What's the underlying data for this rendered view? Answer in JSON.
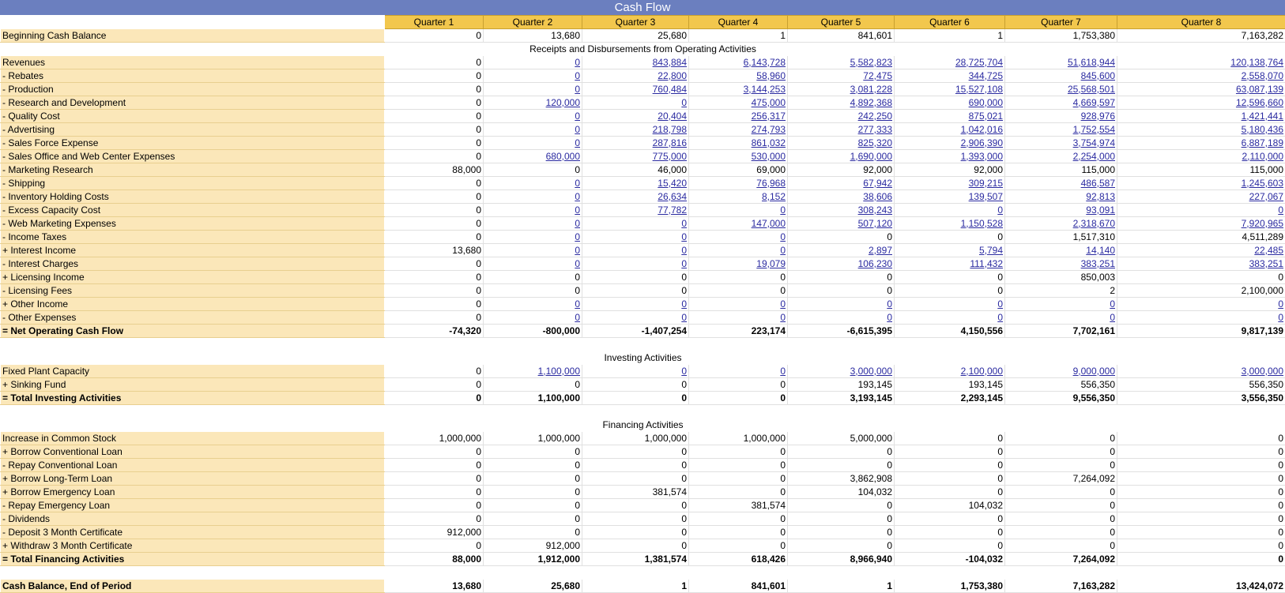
{
  "title": "Cash Flow",
  "quarters": [
    "Quarter 1",
    "Quarter 2",
    "Quarter 3",
    "Quarter 4",
    "Quarter 5",
    "Quarter 6",
    "Quarter 7",
    "Quarter 8"
  ],
  "colors": {
    "title_bar": "#6b7fbf",
    "header": "#f2c74d",
    "label_bg": "#fbe7b9",
    "link": "#2a2aa0"
  },
  "sections": [
    {
      "type": "rows",
      "rows": [
        {
          "label": "Beginning Cash Balance",
          "values": [
            "0",
            "13,680",
            "25,680",
            "1",
            "841,601",
            "1",
            "1,753,380",
            "7,163,282"
          ],
          "links": []
        }
      ]
    },
    {
      "type": "section",
      "title": "Receipts and Disbursements from Operating Activities"
    },
    {
      "type": "rows",
      "rows": [
        {
          "label": "Revenues",
          "values": [
            "0",
            "0",
            "843,884",
            "6,143,728",
            "5,582,823",
            "28,725,704",
            "51,618,944",
            "120,138,764"
          ],
          "links": [
            1,
            2,
            3,
            4,
            5,
            6,
            7
          ]
        },
        {
          "label": "- Rebates",
          "values": [
            "0",
            "0",
            "22,800",
            "58,960",
            "72,475",
            "344,725",
            "845,600",
            "2,558,070"
          ],
          "links": [
            1,
            2,
            3,
            4,
            5,
            6,
            7
          ]
        },
        {
          "label": "- Production",
          "values": [
            "0",
            "0",
            "760,484",
            "3,144,253",
            "3,081,228",
            "15,527,108",
            "25,568,501",
            "63,087,139"
          ],
          "links": [
            1,
            2,
            3,
            4,
            5,
            6,
            7
          ]
        },
        {
          "label": "- Research and Development",
          "values": [
            "0",
            "120,000",
            "0",
            "475,000",
            "4,892,368",
            "690,000",
            "4,669,597",
            "12,596,660"
          ],
          "links": [
            1,
            2,
            3,
            4,
            5,
            6,
            7
          ]
        },
        {
          "label": "- Quality Cost",
          "values": [
            "0",
            "0",
            "20,404",
            "256,317",
            "242,250",
            "875,021",
            "928,976",
            "1,421,441"
          ],
          "links": [
            1,
            2,
            3,
            4,
            5,
            6,
            7
          ]
        },
        {
          "label": "- Advertising",
          "values": [
            "0",
            "0",
            "218,798",
            "274,793",
            "277,333",
            "1,042,016",
            "1,752,554",
            "5,180,436"
          ],
          "links": [
            1,
            2,
            3,
            4,
            5,
            6,
            7
          ]
        },
        {
          "label": "- Sales Force Expense",
          "values": [
            "0",
            "0",
            "287,816",
            "861,032",
            "825,320",
            "2,906,390",
            "3,754,974",
            "6,887,189"
          ],
          "links": [
            1,
            2,
            3,
            4,
            5,
            6,
            7
          ]
        },
        {
          "label": "- Sales Office and Web Center Expenses",
          "values": [
            "0",
            "680,000",
            "775,000",
            "530,000",
            "1,690,000",
            "1,393,000",
            "2,254,000",
            "2,110,000"
          ],
          "links": [
            1,
            2,
            3,
            4,
            5,
            6,
            7
          ]
        },
        {
          "label": "- Marketing Research",
          "values": [
            "88,000",
            "0",
            "46,000",
            "69,000",
            "92,000",
            "92,000",
            "115,000",
            "115,000"
          ],
          "links": []
        },
        {
          "label": "- Shipping",
          "values": [
            "0",
            "0",
            "15,420",
            "76,968",
            "67,942",
            "309,215",
            "486,587",
            "1,245,603"
          ],
          "links": [
            1,
            2,
            3,
            4,
            5,
            6,
            7
          ]
        },
        {
          "label": "- Inventory Holding Costs",
          "values": [
            "0",
            "0",
            "26,634",
            "8,152",
            "38,606",
            "139,507",
            "92,813",
            "227,067"
          ],
          "links": [
            1,
            2,
            3,
            4,
            5,
            6,
            7
          ]
        },
        {
          "label": "- Excess Capacity Cost",
          "values": [
            "0",
            "0",
            "77,782",
            "0",
            "308,243",
            "0",
            "93,091",
            "0"
          ],
          "links": [
            1,
            2,
            3,
            4,
            5,
            6,
            7
          ]
        },
        {
          "label": "- Web Marketing Expenses",
          "values": [
            "0",
            "0",
            "0",
            "147,000",
            "507,120",
            "1,150,528",
            "2,318,670",
            "7,920,965"
          ],
          "links": [
            1,
            2,
            3,
            4,
            5,
            6,
            7
          ]
        },
        {
          "label": "- Income Taxes",
          "values": [
            "0",
            "0",
            "0",
            "0",
            "0",
            "0",
            "1,517,310",
            "4,511,289"
          ],
          "links": [
            1,
            2,
            3
          ]
        },
        {
          "label": "+ Interest Income",
          "values": [
            "13,680",
            "0",
            "0",
            "0",
            "2,897",
            "5,794",
            "14,140",
            "22,485"
          ],
          "links": [
            1,
            2,
            3,
            4,
            5,
            6,
            7
          ]
        },
        {
          "label": "- Interest Charges",
          "values": [
            "0",
            "0",
            "0",
            "19,079",
            "106,230",
            "111,432",
            "383,251",
            "383,251"
          ],
          "links": [
            1,
            2,
            3,
            4,
            5,
            6,
            7
          ]
        },
        {
          "label": "+ Licensing Income",
          "values": [
            "0",
            "0",
            "0",
            "0",
            "0",
            "0",
            "850,003",
            "0"
          ],
          "links": []
        },
        {
          "label": "- Licensing Fees",
          "values": [
            "0",
            "0",
            "0",
            "0",
            "0",
            "0",
            "2",
            "2,100,000"
          ],
          "links": []
        },
        {
          "label": "+ Other Income",
          "values": [
            "0",
            "0",
            "0",
            "0",
            "0",
            "0",
            "0",
            "0"
          ],
          "links": [
            1,
            2,
            3,
            4,
            5,
            6,
            7
          ]
        },
        {
          "label": "- Other Expenses",
          "values": [
            "0",
            "0",
            "0",
            "0",
            "0",
            "0",
            "0",
            "0"
          ],
          "links": [
            1,
            2,
            3,
            4,
            5,
            6,
            7
          ]
        },
        {
          "label": "= Net Operating Cash Flow",
          "values": [
            "-74,320",
            "-800,000",
            "-1,407,254",
            "223,174",
            "-6,615,395",
            "4,150,556",
            "7,702,161",
            "9,817,139"
          ],
          "links": [],
          "total": true
        }
      ]
    },
    {
      "type": "spacer"
    },
    {
      "type": "section",
      "title": "Investing Activities"
    },
    {
      "type": "rows",
      "rows": [
        {
          "label": "Fixed Plant Capacity",
          "values": [
            "0",
            "1,100,000",
            "0",
            "0",
            "3,000,000",
            "2,100,000",
            "9,000,000",
            "3,000,000"
          ],
          "links": [
            1,
            2,
            3,
            4,
            5,
            6,
            7
          ]
        },
        {
          "label": "+ Sinking Fund",
          "values": [
            "0",
            "0",
            "0",
            "0",
            "193,145",
            "193,145",
            "556,350",
            "556,350"
          ],
          "links": []
        },
        {
          "label": "= Total Investing Activities",
          "values": [
            "0",
            "1,100,000",
            "0",
            "0",
            "3,193,145",
            "2,293,145",
            "9,556,350",
            "3,556,350"
          ],
          "links": [],
          "total": true
        }
      ]
    },
    {
      "type": "spacer"
    },
    {
      "type": "section",
      "title": "Financing Activities"
    },
    {
      "type": "rows",
      "rows": [
        {
          "label": "Increase in Common Stock",
          "values": [
            "1,000,000",
            "1,000,000",
            "1,000,000",
            "1,000,000",
            "5,000,000",
            "0",
            "0",
            "0"
          ],
          "links": []
        },
        {
          "label": "+ Borrow Conventional Loan",
          "values": [
            "0",
            "0",
            "0",
            "0",
            "0",
            "0",
            "0",
            "0"
          ],
          "links": []
        },
        {
          "label": "- Repay Conventional Loan",
          "values": [
            "0",
            "0",
            "0",
            "0",
            "0",
            "0",
            "0",
            "0"
          ],
          "links": []
        },
        {
          "label": "+ Borrow Long-Term Loan",
          "values": [
            "0",
            "0",
            "0",
            "0",
            "3,862,908",
            "0",
            "7,264,092",
            "0"
          ],
          "links": []
        },
        {
          "label": "+ Borrow Emergency Loan",
          "values": [
            "0",
            "0",
            "381,574",
            "0",
            "104,032",
            "0",
            "0",
            "0"
          ],
          "links": []
        },
        {
          "label": "- Repay Emergency Loan",
          "values": [
            "0",
            "0",
            "0",
            "381,574",
            "0",
            "104,032",
            "0",
            "0"
          ],
          "links": []
        },
        {
          "label": "- Dividends",
          "values": [
            "0",
            "0",
            "0",
            "0",
            "0",
            "0",
            "0",
            "0"
          ],
          "links": []
        },
        {
          "label": "- Deposit 3 Month Certificate",
          "values": [
            "912,000",
            "0",
            "0",
            "0",
            "0",
            "0",
            "0",
            "0"
          ],
          "links": []
        },
        {
          "label": "+ Withdraw 3 Month Certificate",
          "values": [
            "0",
            "912,000",
            "0",
            "0",
            "0",
            "0",
            "0",
            "0"
          ],
          "links": []
        },
        {
          "label": "= Total Financing Activities",
          "values": [
            "88,000",
            "1,912,000",
            "1,381,574",
            "618,426",
            "8,966,940",
            "-104,032",
            "7,264,092",
            "0"
          ],
          "links": [],
          "total": true
        }
      ]
    },
    {
      "type": "spacer"
    },
    {
      "type": "rows",
      "rows": [
        {
          "label": "Cash Balance, End of Period",
          "values": [
            "13,680",
            "25,680",
            "1",
            "841,601",
            "1",
            "1,753,380",
            "7,163,282",
            "13,424,072"
          ],
          "links": [],
          "total": true
        }
      ]
    }
  ]
}
